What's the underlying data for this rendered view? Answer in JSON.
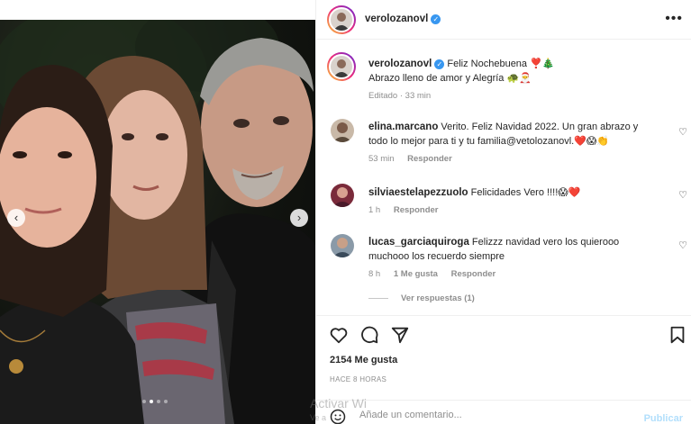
{
  "post": {
    "username": "verolozanovl",
    "more_icon": "more-horizontal-icon"
  },
  "caption": {
    "username": "verolozanovl",
    "line1": "Feliz Nochebuena ❣️🎄",
    "line2": "Abrazo lleno de amor y Alegría 🐢🎅",
    "edited": "Editado · 33 min"
  },
  "comments": [
    {
      "username": "elina.marcano",
      "text": "Verito. Feliz Navidad 2022. Un gran abrazo y todo lo mejor para ti y tu familia@vetolozanovl.❤️😱👏",
      "time": "53 min",
      "likes": "",
      "reply": "Responder"
    },
    {
      "username": "silviaestelapezzuolo",
      "text": "Felicidades Vero !!!!😱❤️",
      "time": "1 h",
      "likes": "",
      "reply": "Responder"
    },
    {
      "username": "lucas_garciaquiroga",
      "text": "Felizzz navidad vero los quierooo muchooo los recuerdo siempre",
      "time": "8 h",
      "likes": "1 Me gusta",
      "reply": "Responder",
      "view_replies": "Ver respuestas (1)"
    }
  ],
  "actions": {
    "icons": [
      "heart-icon",
      "comment-icon",
      "share-icon",
      "bookmark-icon"
    ]
  },
  "likes": "2154 Me gusta",
  "posted": "HACE 8 HORAS",
  "composer": {
    "placeholder": "Añade un comentario...",
    "publish": "Publicar"
  },
  "carousel": {
    "slide_count": 4,
    "active_index": 1
  },
  "watermark": {
    "line1": "Activar Wi",
    "line2": "Ve a"
  },
  "colors": {
    "link_blue": "#3897f0",
    "muted": "#8e8e8e",
    "publish_disabled": "#b2dffc"
  }
}
